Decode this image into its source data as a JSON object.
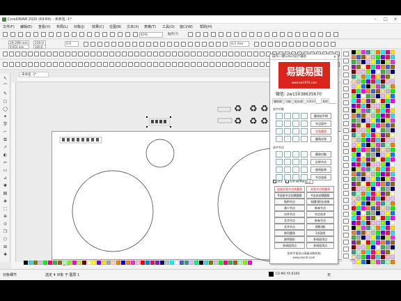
{
  "window": {
    "title": "CorelDRAW 2020 (64-Bit) - 未命名 -1*"
  },
  "menubar": {
    "items": [
      "文件(F)",
      "编辑(E)",
      "查看(V)",
      "布局(L)",
      "对象(J)",
      "效果(C)",
      "位图(B)",
      "文本(X)",
      "表格(T)",
      "工具(O)",
      "窗口(W)",
      "帮助(H)"
    ]
  },
  "toolbar": {
    "zoom": "63%",
    "snap_label": "贴齐(T)",
    "x_value": "29.298 mm",
    "y_value": "9.653 mm",
    "w_value": "100.0",
    "h_value": "100.0",
    "pct": "%",
    "angle": "0.0",
    "outline": "0.2 mm"
  },
  "document_tab": {
    "label": "未命名 -1*"
  },
  "page_nav": {
    "page_label": "页 1"
  },
  "status": {
    "hint": "对象细节",
    "selection": "选定 4 对象 于 图层 1",
    "color_info": "C0 M0 Y0 K100",
    "fill_label": "无"
  },
  "plugin": {
    "header": "操作一键LOGO设计辅助",
    "close": "×",
    "logo_text": "易键易图",
    "logo_url": "www.zw1976.com",
    "wechat_label": "微信:",
    "wechat_id": "zw15038635670",
    "tabs": [
      "辅助操",
      "功能",
      "批处理",
      "LOGO",
      "其他"
    ],
    "section_object": "选中对象",
    "section_node": "选中节点",
    "object_buttons": [
      "圆润加手柄",
      "节点居中",
      "尖角圆角",
      "圆角尖角"
    ],
    "node_buttons": [
      "删除对象",
      "反转节点",
      "曲线延伸",
      "节点连接"
    ],
    "check_select": "选全",
    "check_all": "全新",
    "check_circle": "圆角值",
    "circle_value": "6.3",
    "grid_buttons": [
      [
        "连接实弧节点转圆角",
        "实弧节点转圆角"
      ],
      [
        "#选段节点创建圆角",
        "#自由创建圆角"
      ],
      [
        "贴附节点",
        "平滑节点"
      ],
      [
        "减少节点",
        "节点居中"
      ],
      [
        "对齐节点",
        "增加节点"
      ],
      [
        "文字节点",
        "四线锚点"
      ],
      [
        "文字节点",
        "文本转换"
      ],
      [
        "斜切圆角",
        "切点"
      ],
      [
        "曲率图形",
        "节点合并"
      ],
      [
        "多线段顶点",
        "多线段顶点"
      ]
    ],
    "grid_right": [
      "实弧节点转圆角",
      "#自由创建圆角",
      "贴膜(图)拉成角",
      "新来节点",
      "节点合并",
      "新来节点",
      "奇数(偶)",
      "3点画线",
      "多线段顶点",
      "多线段顶点"
    ],
    "footer_line1": "张伟平面设计高级训练机构",
    "footer_line2": "www.zwcdr.com"
  },
  "colors": {
    "accent_red": "#d9251c",
    "ui_bg": "#ececec"
  }
}
